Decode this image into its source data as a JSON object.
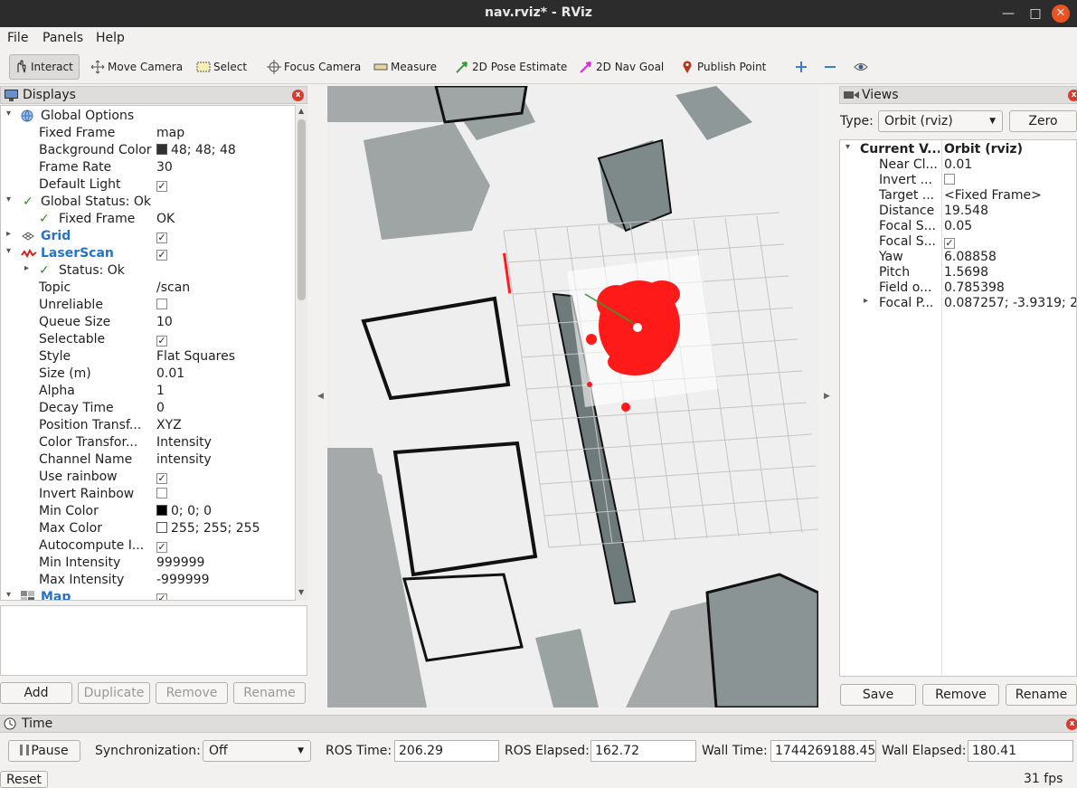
{
  "window": {
    "title": "nav.rviz* - RViz"
  },
  "menu": {
    "file": "File",
    "panels": "Panels",
    "help": "Help"
  },
  "toolbar": {
    "interact": "Interact",
    "move_camera": "Move Camera",
    "select": "Select",
    "focus_camera": "Focus Camera",
    "measure": "Measure",
    "pose_estimate": "2D Pose Estimate",
    "nav_goal": "2D Nav Goal",
    "publish_point": "Publish Point"
  },
  "displays": {
    "title": "Displays",
    "rows": [
      {
        "key": "Global Options",
        "value": ""
      },
      {
        "key": "Fixed Frame",
        "value": "map"
      },
      {
        "key": "Background Color",
        "value": "48; 48; 48"
      },
      {
        "key": "Frame Rate",
        "value": "30"
      },
      {
        "key": "Default Light",
        "value": ""
      },
      {
        "key": "Global Status: Ok",
        "value": ""
      },
      {
        "key": "Fixed Frame",
        "value": "OK"
      },
      {
        "key": "Grid",
        "value": ""
      },
      {
        "key": "LaserScan",
        "value": ""
      },
      {
        "key": "Status: Ok",
        "value": ""
      },
      {
        "key": "Topic",
        "value": "/scan"
      },
      {
        "key": "Unreliable",
        "value": ""
      },
      {
        "key": "Queue Size",
        "value": "10"
      },
      {
        "key": "Selectable",
        "value": ""
      },
      {
        "key": "Style",
        "value": "Flat Squares"
      },
      {
        "key": "Size (m)",
        "value": "0.01"
      },
      {
        "key": "Alpha",
        "value": "1"
      },
      {
        "key": "Decay Time",
        "value": "0"
      },
      {
        "key": "Position Transf...",
        "value": "XYZ"
      },
      {
        "key": "Color Transfor...",
        "value": "Intensity"
      },
      {
        "key": "Channel Name",
        "value": "intensity"
      },
      {
        "key": "Use rainbow",
        "value": ""
      },
      {
        "key": "Invert Rainbow",
        "value": ""
      },
      {
        "key": "Min Color",
        "value": "0; 0; 0"
      },
      {
        "key": "Max Color",
        "value": "255; 255; 255"
      },
      {
        "key": "Autocompute I...",
        "value": ""
      },
      {
        "key": "Min Intensity",
        "value": "999999"
      },
      {
        "key": "Max Intensity",
        "value": "-999999"
      },
      {
        "key": "Map",
        "value": ""
      }
    ],
    "buttons": {
      "add": "Add",
      "duplicate": "Duplicate",
      "remove": "Remove",
      "rename": "Rename"
    }
  },
  "views": {
    "title": "Views",
    "type_label": "Type:",
    "type_value": "Orbit (rviz)",
    "zero": "Zero",
    "rows": [
      {
        "key": "Current V...",
        "value": "Orbit (rviz)"
      },
      {
        "key": "Near Cl...",
        "value": "0.01"
      },
      {
        "key": "Invert ...",
        "value": ""
      },
      {
        "key": "Target ...",
        "value": "<Fixed Frame>"
      },
      {
        "key": "Distance",
        "value": "19.548"
      },
      {
        "key": "Focal S...",
        "value": "0.05"
      },
      {
        "key": "Focal S...",
        "value": ""
      },
      {
        "key": "Yaw",
        "value": "6.08858"
      },
      {
        "key": "Pitch",
        "value": "1.5698"
      },
      {
        "key": "Field o...",
        "value": "0.785398"
      },
      {
        "key": "Focal P...",
        "value": "0.087257; -3.9319; 2..."
      }
    ],
    "buttons": {
      "save": "Save",
      "remove": "Remove",
      "rename": "Rename"
    }
  },
  "time": {
    "title": "Time",
    "pause": "Pause",
    "sync_label": "Synchronization:",
    "sync_value": "Off",
    "ros_time_label": "ROS Time:",
    "ros_time": "206.29",
    "ros_elapsed_label": "ROS Elapsed:",
    "ros_elapsed": "162.72",
    "wall_time_label": "Wall Time:",
    "wall_time": "1744269188.45",
    "wall_elapsed_label": "Wall Elapsed:",
    "wall_elapsed": "180.41",
    "reset": "Reset",
    "fps": "31 fps"
  },
  "colors": {
    "background_swatch": "#303030",
    "laser": "#ff1a1a",
    "link": "#2573c9",
    "ok_check": "#2e8b2e"
  }
}
